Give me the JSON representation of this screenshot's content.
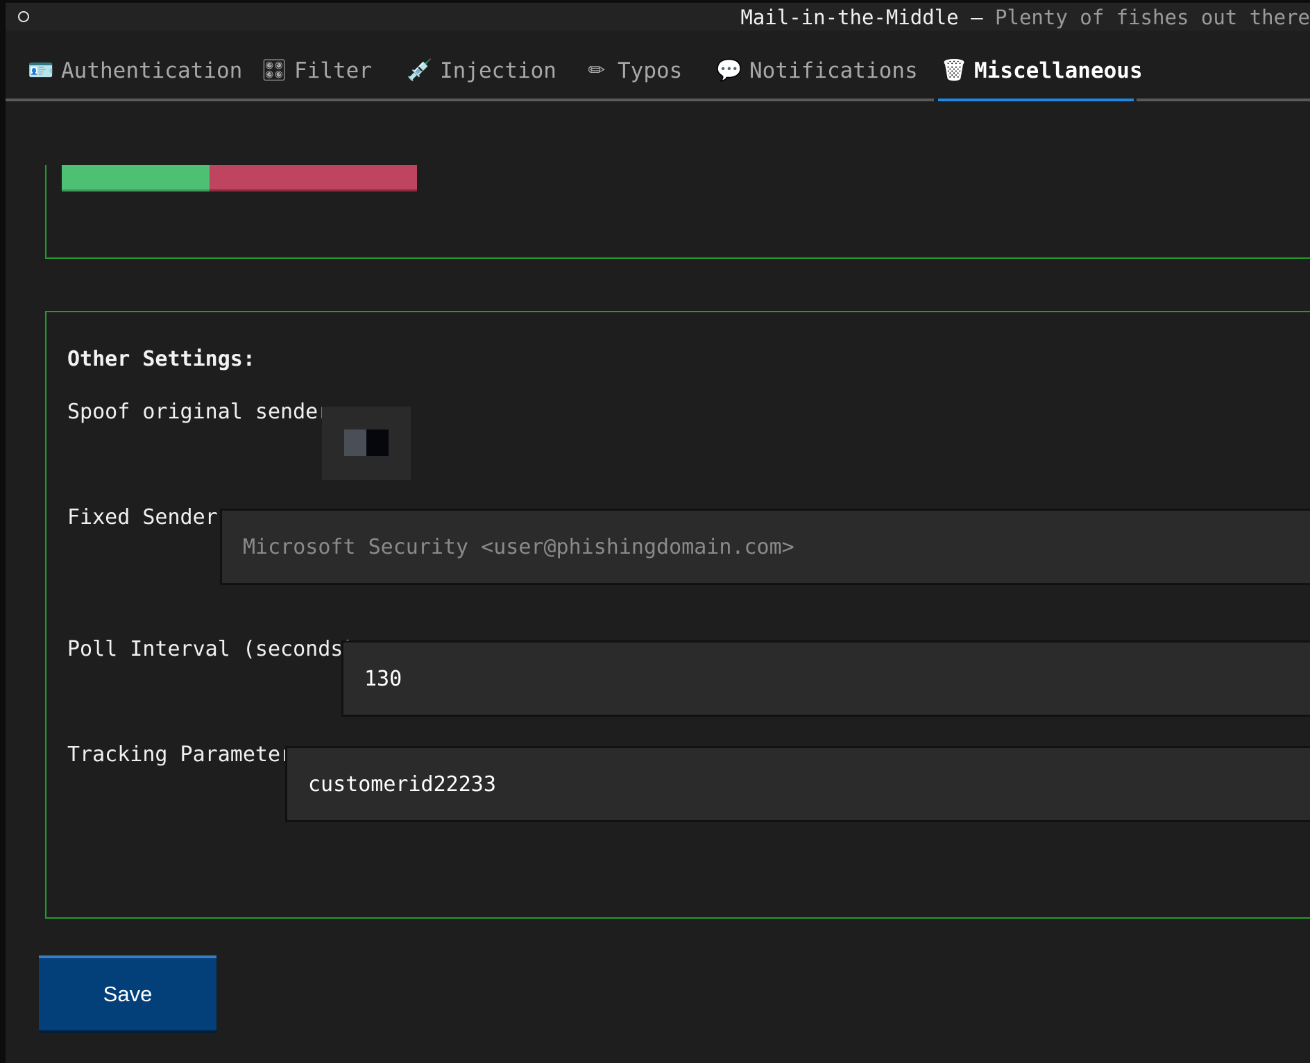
{
  "titlebar": {
    "app_name": "Mail-in-the-Middle",
    "separator": " – ",
    "tagline": "Plenty of fishes out there"
  },
  "tabs": [
    {
      "label": "Authentication",
      "icon": "id-card-icon",
      "glyph": "🪪",
      "active": false
    },
    {
      "label": "Filter",
      "icon": "control-knobs-icon",
      "glyph": "🎛",
      "active": false
    },
    {
      "label": "Injection",
      "icon": "syringe-icon",
      "glyph": "💉",
      "active": false
    },
    {
      "label": "Typos",
      "icon": "pencil-icon",
      "glyph": "✏",
      "active": false
    },
    {
      "label": "Notifications",
      "icon": "speech-bubble-icon",
      "glyph": "💬",
      "active": false
    },
    {
      "label": "Miscellaneous",
      "icon": "wastebasket-icon",
      "glyph": "🗑",
      "active": true
    }
  ],
  "progress": {
    "fraction_success": 0.416,
    "colors": {
      "success": "#4ec074",
      "failure": "#bf4460"
    }
  },
  "other_settings": {
    "title": "Other Settings:",
    "spoof_label": "Spoof original sender:",
    "spoof_enabled": false,
    "fixed_sender_label": "Fixed Sender:",
    "fixed_sender_value": "",
    "fixed_sender_placeholder": "Microsoft Security <user@phishingdomain.com>",
    "poll_interval_label": "Poll Interval (seconds):",
    "poll_interval_value": "130",
    "tracking_label": "Tracking Parameter:",
    "tracking_value": "customerid22233"
  },
  "actions": {
    "save_label": "Save"
  },
  "colors": {
    "accent": "#1e88e5",
    "panel_border": "#1f9e2a",
    "save_button": "#034079",
    "background": "#1e1e1e"
  }
}
